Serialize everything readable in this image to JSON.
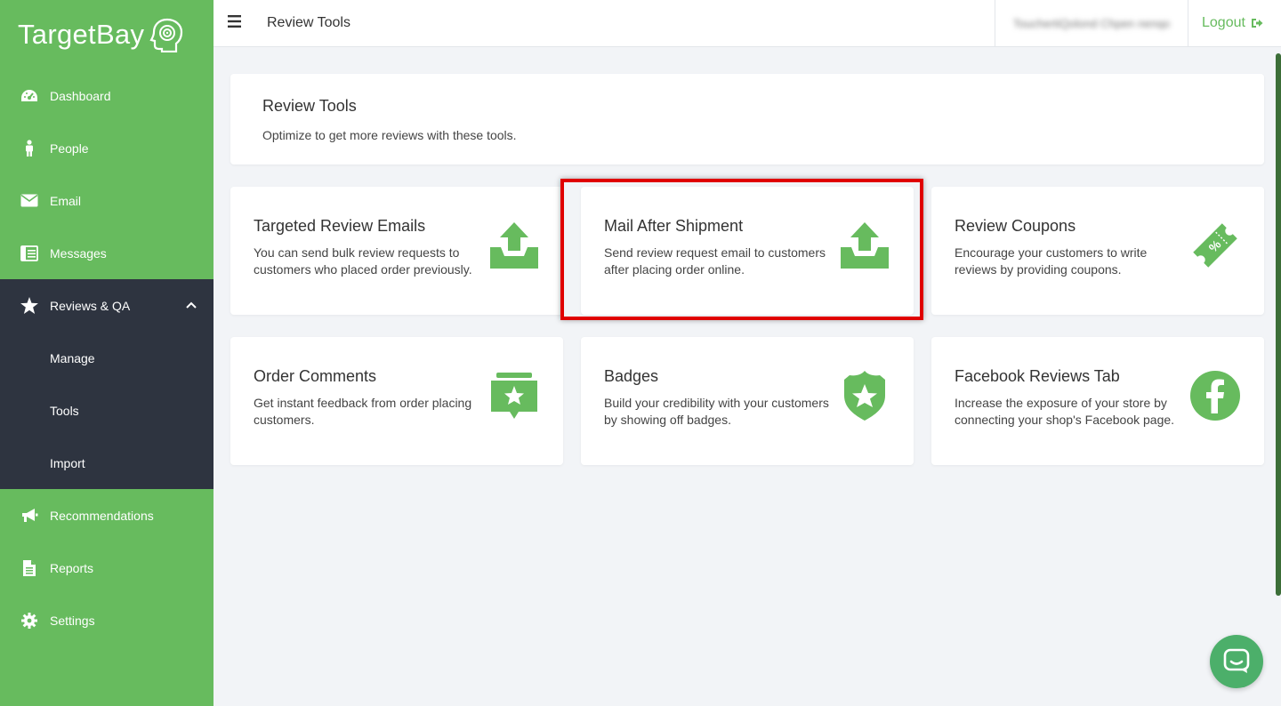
{
  "brand": {
    "name": "TargetBay",
    "icon": "head-target-icon"
  },
  "colors": {
    "accent": "#67bb5e",
    "sidebar_dark": "#2e3440",
    "highlight": "#e00000"
  },
  "sidebar": {
    "items": [
      {
        "label": "Dashboard",
        "icon": "dashboard-icon"
      },
      {
        "label": "People",
        "icon": "person-icon"
      },
      {
        "label": "Email",
        "icon": "envelope-icon"
      },
      {
        "label": "Messages",
        "icon": "messages-icon"
      },
      {
        "label": "Reviews & QA",
        "icon": "star-icon",
        "expanded": true
      },
      {
        "label": "Recommendations",
        "icon": "megaphone-icon"
      },
      {
        "label": "Reports",
        "icon": "report-icon"
      },
      {
        "label": "Settings",
        "icon": "gear-icon"
      }
    ],
    "subitems": [
      {
        "label": "Manage"
      },
      {
        "label": "Tools"
      },
      {
        "label": "Import"
      }
    ]
  },
  "topbar": {
    "title": "Review Tools",
    "user": "TouchertiQolond Chpen nenqo",
    "logout": "Logout"
  },
  "header": {
    "title": "Review Tools",
    "subtitle": "Optimize to get more reviews with these tools."
  },
  "cards": [
    {
      "title": "Targeted Review Emails",
      "desc": "You can send bulk review requests to customers who placed order previously.",
      "icon": "inbox-upload-icon"
    },
    {
      "title": "Mail After Shipment",
      "desc": "Send review request email to customers after placing order online.",
      "icon": "inbox-upload-icon"
    },
    {
      "title": "Review Coupons",
      "desc": "Encourage your customers to write reviews by providing coupons.",
      "icon": "coupon-icon"
    },
    {
      "title": "Order Comments",
      "desc": "Get instant feedback from order placing customers.",
      "icon": "comment-star-icon"
    },
    {
      "title": "Badges",
      "desc": "Build your credibility with your customers by showing off badges.",
      "icon": "badge-star-icon"
    },
    {
      "title": "Facebook Reviews Tab",
      "desc": "Increase the exposure of your store by connecting your shop's Facebook page.",
      "icon": "facebook-icon"
    }
  ],
  "chat": {
    "icon": "chat-icon"
  }
}
